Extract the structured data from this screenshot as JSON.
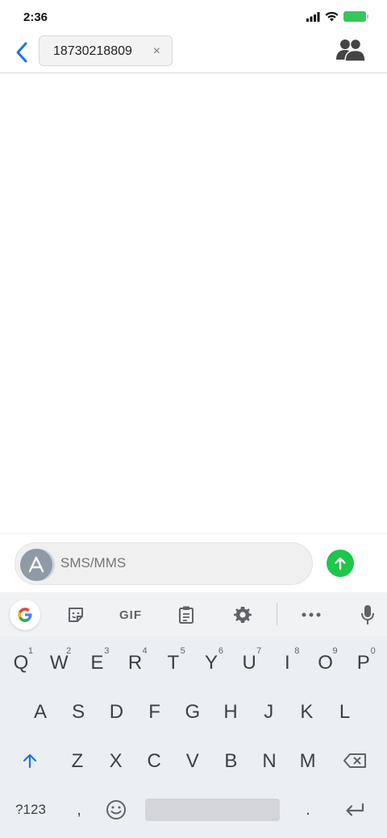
{
  "status_bar": {
    "time": "2:36",
    "icons": [
      "signal-icon",
      "wifi-icon",
      "battery-icon"
    ]
  },
  "header": {
    "recipient": "18730218809",
    "chip_close": "×"
  },
  "compose": {
    "placeholder": "SMS/MMS"
  },
  "keyboard": {
    "toolbar": {
      "gif_label": "GIF"
    },
    "row1": [
      {
        "label": "Q",
        "hint": "1"
      },
      {
        "label": "W",
        "hint": "2"
      },
      {
        "label": "E",
        "hint": "3"
      },
      {
        "label": "R",
        "hint": "4"
      },
      {
        "label": "T",
        "hint": "5"
      },
      {
        "label": "Y",
        "hint": "6"
      },
      {
        "label": "U",
        "hint": "7"
      },
      {
        "label": "I",
        "hint": "8"
      },
      {
        "label": "O",
        "hint": "9"
      },
      {
        "label": "P",
        "hint": "0"
      }
    ],
    "row2": [
      "A",
      "S",
      "D",
      "F",
      "G",
      "H",
      "J",
      "K",
      "L"
    ],
    "row3": [
      "Z",
      "X",
      "C",
      "V",
      "B",
      "N",
      "M"
    ],
    "row4": {
      "symbols": "?123",
      "comma": ",",
      "period": "."
    }
  },
  "colors": {
    "accent_blue": "#1a73e8",
    "send_green": "#1cc74a",
    "battery_green": "#35c759"
  }
}
